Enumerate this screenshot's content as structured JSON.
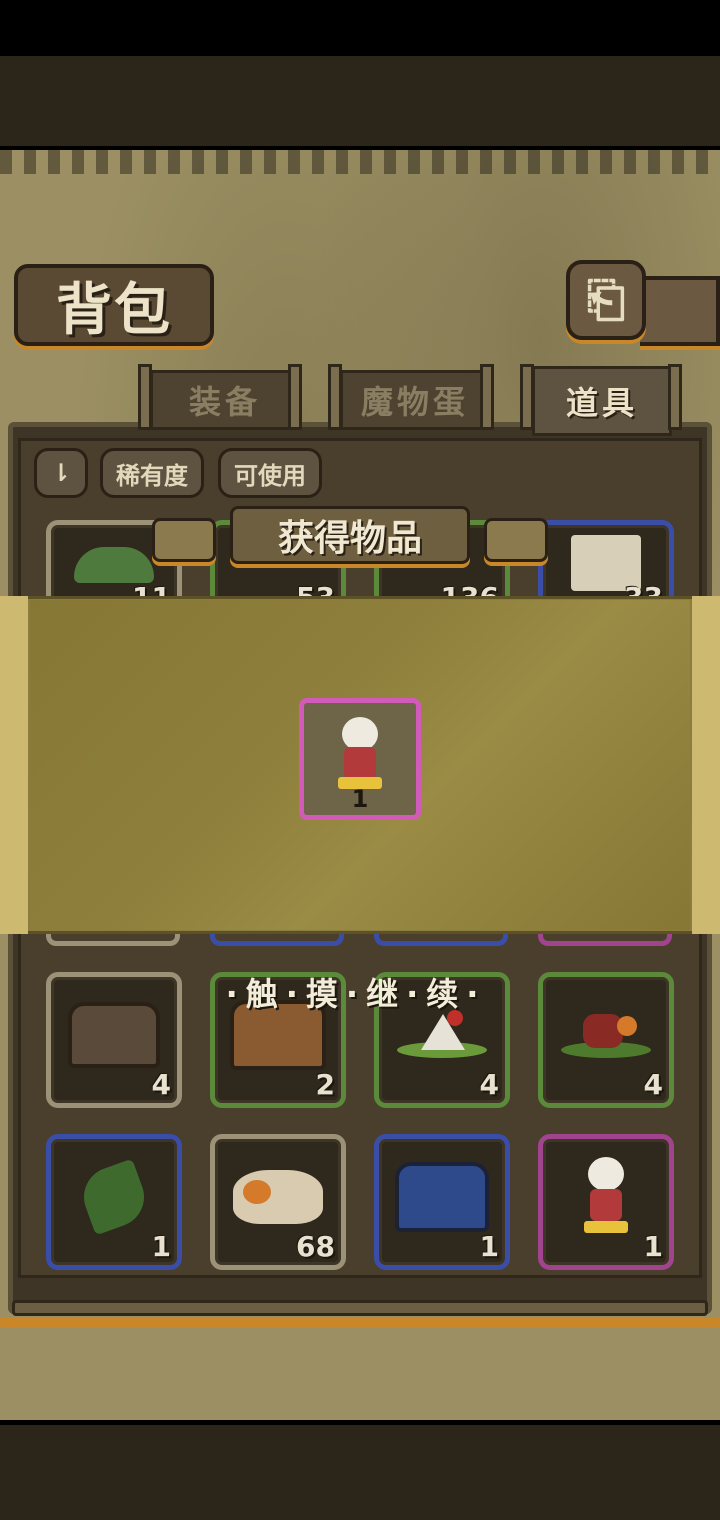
{
  "header": {
    "title": "背包"
  },
  "tabs": [
    {
      "label": "装备",
      "active": false
    },
    {
      "label": "魔物蛋",
      "active": false
    },
    {
      "label": "道具",
      "active": true
    }
  ],
  "filters": {
    "rarity_label": "稀有度",
    "usable_label": "可使用"
  },
  "top_row_counts": [
    "11",
    "53",
    "136",
    "33"
  ],
  "grid_rows": [
    [
      {
        "item": "wooden-chest",
        "count": "4",
        "rarity": "gray"
      },
      {
        "item": "treasure-chest",
        "count": "2",
        "rarity": "green"
      },
      {
        "item": "rice-cake-item",
        "count": "4",
        "rarity": "green"
      },
      {
        "item": "meat-item",
        "count": "4",
        "rarity": "green"
      }
    ],
    [
      {
        "item": "herb-leaf",
        "count": "1",
        "rarity": "blue"
      },
      {
        "item": "rice-sack",
        "count": "68",
        "rarity": "gray"
      },
      {
        "item": "blue-chest",
        "count": "1",
        "rarity": "blue"
      },
      {
        "item": "character-figure",
        "count": "1",
        "rarity": "purple"
      }
    ]
  ],
  "reward_popup": {
    "title": "获得物品",
    "item": "character-figure",
    "count": "1"
  },
  "continue_hint": "·触·摸·继·续·",
  "colors": {
    "accent_orange": "#c9872a",
    "purple_rarity": "#d25ab8",
    "blue_rarity": "#3a4ea8",
    "green_rarity": "#5a8a3a"
  }
}
